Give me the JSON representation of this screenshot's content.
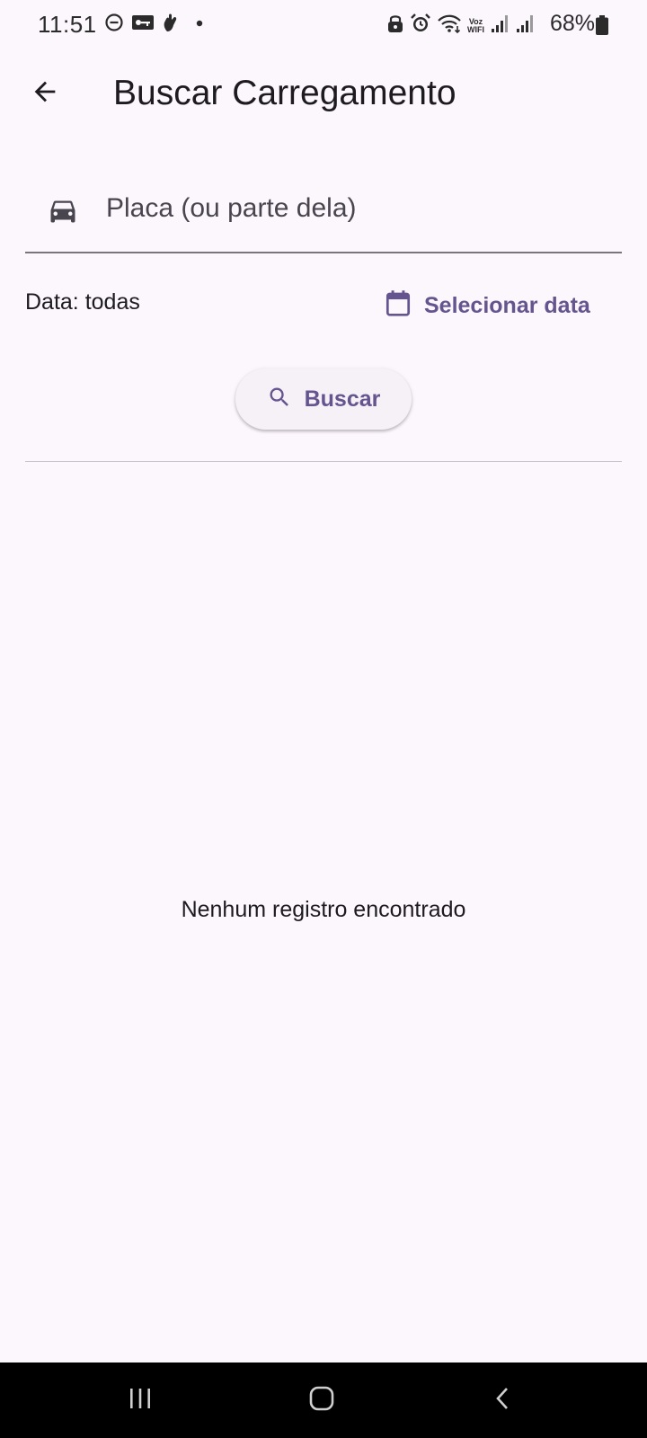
{
  "status_bar": {
    "time": "11:51",
    "battery_percent": "68%",
    "wifi_calling_label_top": "Voz",
    "wifi_calling_label_bottom": "WIFI",
    "left_icons": [
      "do-not-disturb-icon",
      "key-icon",
      "hand-icon",
      "dot-icon"
    ],
    "right_icons": [
      "lock-icon",
      "alarm-icon",
      "wifi-icon",
      "signal-icon",
      "signal-icon",
      "battery-icon"
    ]
  },
  "app_bar": {
    "title": "Buscar Carregamento",
    "back_icon": "arrow-back-icon"
  },
  "plate_field": {
    "icon": "car-icon",
    "placeholder": "Placa (ou parte dela)",
    "value": ""
  },
  "date_filter": {
    "label": "Data: todas",
    "select_label": "Selecionar data",
    "icon": "calendar-icon"
  },
  "search_button": {
    "label": "Buscar",
    "icon": "search-icon"
  },
  "results": {
    "empty_message": "Nenhum registro encontrado"
  },
  "nav_bar": {
    "buttons": [
      "recent-apps-icon",
      "home-icon",
      "back-icon"
    ]
  },
  "colors": {
    "background": "#fcf6fd",
    "accent": "#65558f",
    "text": "#1d1b20",
    "nav_bar": "#000000"
  }
}
